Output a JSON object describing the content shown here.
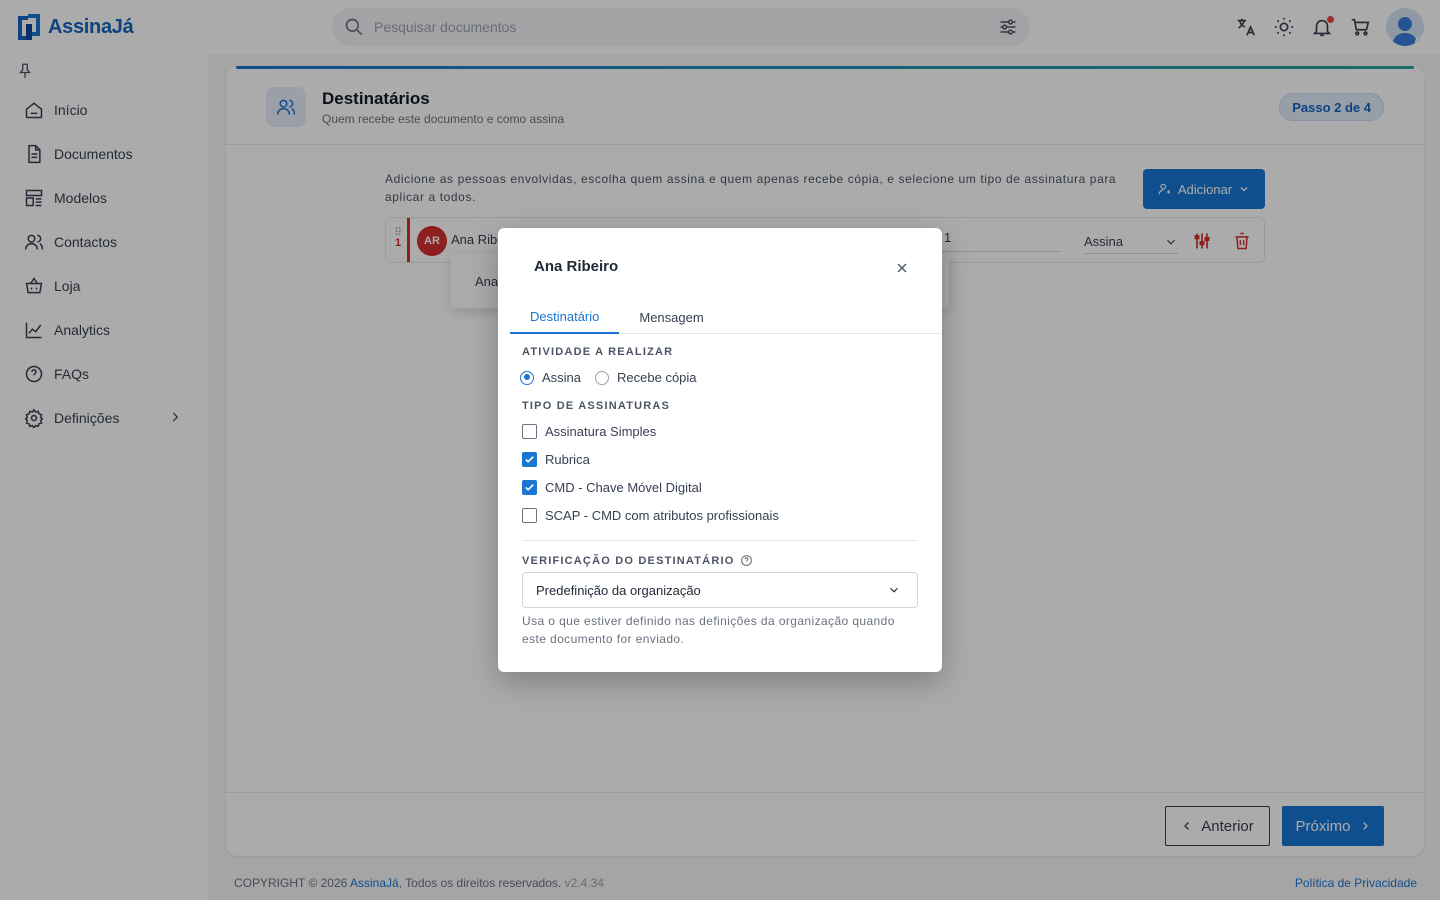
{
  "app": {
    "name": "AssinaJá"
  },
  "search": {
    "placeholder": "Pesquisar documentos"
  },
  "sidebar": {
    "items": [
      {
        "label": "Início"
      },
      {
        "label": "Documentos"
      },
      {
        "label": "Modelos"
      },
      {
        "label": "Contactos"
      },
      {
        "label": "Loja"
      },
      {
        "label": "Analytics"
      },
      {
        "label": "FAQs"
      },
      {
        "label": "Definições"
      }
    ]
  },
  "page": {
    "title": "Destinatários",
    "subtitle": "Quem recebe este documento e como assina",
    "step": "Passo 2 de 4",
    "help": "Adicione as pessoas envolvidas, escolha quem assina e quem apenas recebe cópia, e selecione um tipo de assinatura para aplicar a todos.",
    "add_label": "Adicionar"
  },
  "recipient": {
    "order": "1",
    "initials": "AR",
    "name_partial": "Ana Ribe",
    "order_field": "1",
    "role": "Assina",
    "suggestion": "Ana"
  },
  "footer_nav": {
    "prev": "Anterior",
    "next": "Próximo"
  },
  "footer": {
    "copyright": "COPYRIGHT © 2026",
    "brand": "AssinaJá",
    "rights": ", Todos os direitos reservados.",
    "version": "v2.4.34",
    "privacy": "Política de Privacidade"
  },
  "modal": {
    "title": "Ana Ribeiro",
    "tabs": [
      {
        "label": "Destinatário",
        "active": true
      },
      {
        "label": "Mensagem",
        "active": false
      }
    ],
    "activity": {
      "label": "ATIVIDADE A REALIZAR",
      "options": [
        {
          "label": "Assina",
          "selected": true
        },
        {
          "label": "Recebe cópia",
          "selected": false
        }
      ]
    },
    "signature_types": {
      "label": "TIPO DE ASSINATURAS",
      "options": [
        {
          "label": "Assinatura Simples",
          "checked": false
        },
        {
          "label": "Rubrica",
          "checked": true
        },
        {
          "label": "CMD - Chave Móvel Digital",
          "checked": true
        },
        {
          "label": "SCAP - CMD com atributos profissionais",
          "checked": false
        }
      ]
    },
    "verification": {
      "label": "VERIFICAÇÃO DO DESTINATÁRIO",
      "selected": "Predefinição da organização",
      "help": "Usa o que estiver definido nas definições da organização quando este documento for enviado."
    }
  },
  "colors": {
    "primary": "#1976d2",
    "danger": "#d32f2f",
    "online": "#22c55e"
  }
}
